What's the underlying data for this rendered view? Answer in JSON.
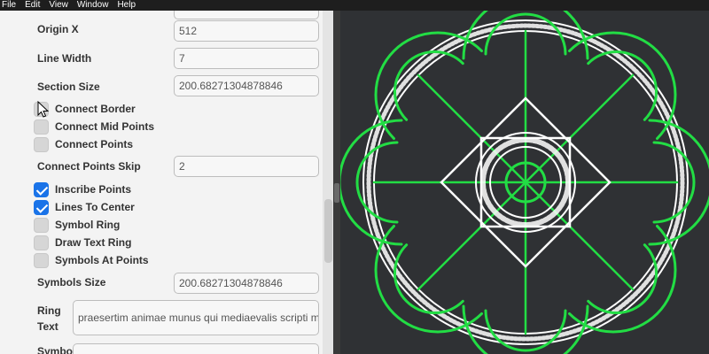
{
  "menu": [
    "File",
    "Edit",
    "View",
    "Window",
    "Help"
  ],
  "fields": {
    "origin_x": {
      "label": "Origin X",
      "value": "512"
    },
    "line_width": {
      "label": "Line Width",
      "value": "7"
    },
    "section_size": {
      "label": "Section Size",
      "value": "200.68271304878846"
    },
    "connect_points_skip": {
      "label": "Connect Points Skip",
      "value": "2"
    },
    "symbols_size": {
      "label": "Symbols Size",
      "value": "200.68271304878846"
    },
    "ring_text": {
      "label": "Ring Text",
      "value": "praesertim animae munus qui mediaevalis scripti met..."
    },
    "symbol": {
      "label": "Symbol"
    }
  },
  "checkboxes": {
    "connect_border": {
      "label": "Connect Border",
      "checked": false
    },
    "connect_mid_points": {
      "label": "Connect Mid Points",
      "checked": false
    },
    "connect_points": {
      "label": "Connect Points",
      "checked": false
    },
    "inscribe_points": {
      "label": "Inscribe Points",
      "checked": true
    },
    "lines_to_center": {
      "label": "Lines To Center",
      "checked": true
    },
    "symbol_ring": {
      "label": "Symbol Ring",
      "checked": false
    },
    "draw_text_ring": {
      "label": "Draw Text Ring",
      "checked": false
    },
    "symbols_at_points": {
      "label": "Symbols At Points",
      "checked": false
    }
  },
  "colors": {
    "canvas_bg": "#2f3134",
    "line_white": "#ffffff",
    "line_green": "#22dd44",
    "check_blue": "#1a73e8"
  },
  "icons": {
    "cursor": "mouse-pointer-icon"
  }
}
